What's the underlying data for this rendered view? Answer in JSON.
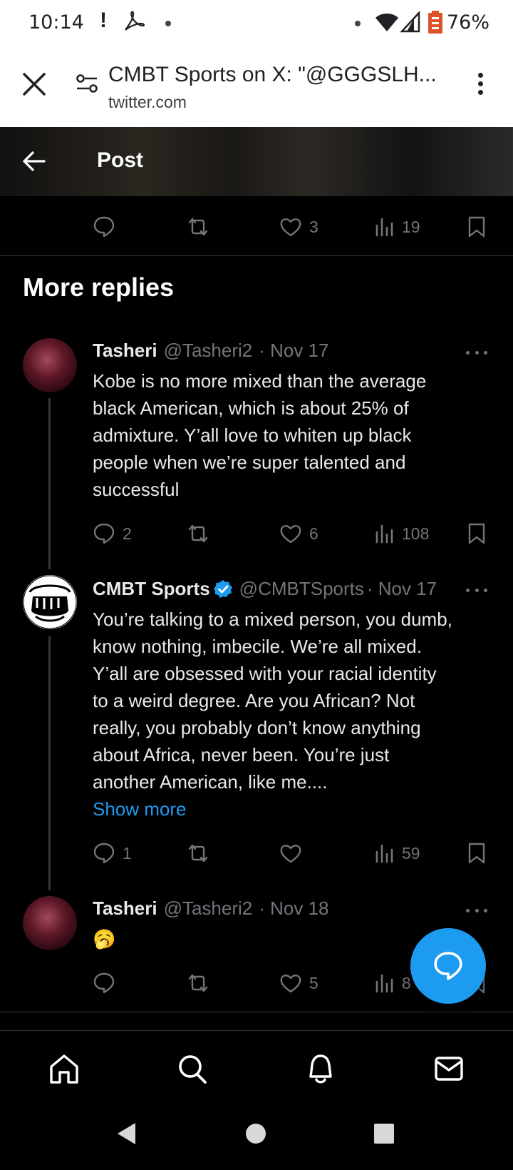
{
  "status_bar": {
    "time": "10:14",
    "alert": "!",
    "battery_percent": "76%"
  },
  "browser": {
    "page_title": "CMBT Sports on X: \"@GGGSLH...",
    "url": "twitter.com"
  },
  "header": {
    "title": "Post"
  },
  "original_post_actions": {
    "replies": "",
    "reposts": "",
    "likes": "3",
    "views": "19"
  },
  "section_title": "More replies",
  "replies": [
    {
      "name": "Tasheri",
      "handle": "@Tasheri2",
      "date": "· Nov 17",
      "text_lines": [
        "Kobe is no more mixed than the average",
        "black American, which is about 25% of",
        "admixture. Y’all love to whiten up black",
        "people when we’re super talented and",
        "successful"
      ],
      "replies": "2",
      "reposts": "",
      "likes": "6",
      "views": "108"
    },
    {
      "name": "CMBT Sports",
      "handle": "@CMBTSports",
      "date": "· Nov 17",
      "verified": true,
      "text_lines": [
        "You’re talking to a mixed person, you dumb,",
        "know nothing, imbecile. We’re all mixed.",
        "Y’all are obsessed with your racial identity",
        "to a weird degree. Are you African? Not",
        "really, you probably don’t know anything",
        "about Africa, never been. You’re just",
        "another American, like me...."
      ],
      "show_more": "Show more",
      "replies": "1",
      "reposts": "",
      "likes": "",
      "views": "59"
    },
    {
      "name": "Tasheri",
      "handle": "@Tasheri2",
      "date": "· Nov 18",
      "text_lines": [
        "🥱"
      ],
      "replies": "",
      "reposts": "",
      "likes": "5",
      "views": "8"
    }
  ],
  "colors": {
    "accent": "#1d9bf0",
    "background": "#000000",
    "secondary_text": "#71767b"
  },
  "icons": {
    "nav": [
      "home-icon",
      "search-icon",
      "notifications-icon",
      "messages-icon"
    ]
  }
}
